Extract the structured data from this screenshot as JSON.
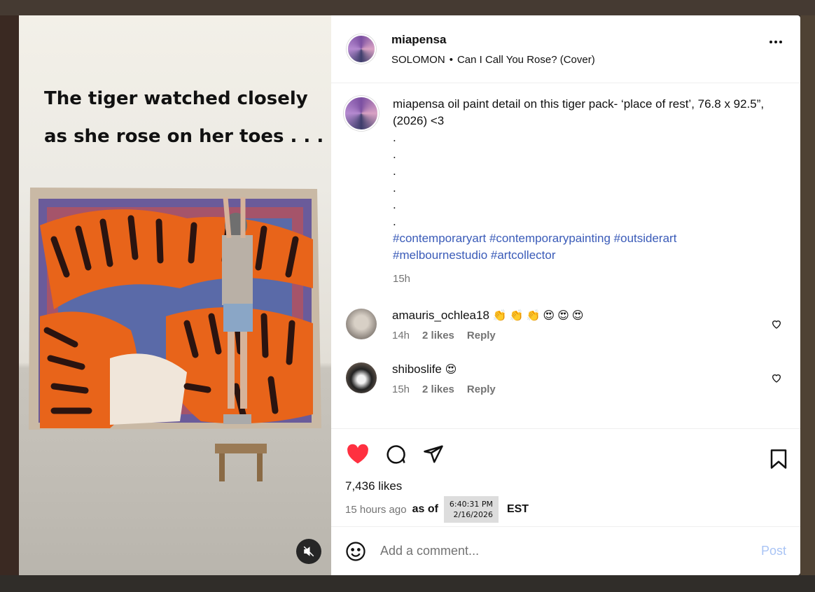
{
  "media": {
    "overlay_text_line1": "The tiger watched closely",
    "overlay_text_line2": "as she rose on her toes . . ."
  },
  "header": {
    "username": "miapensa",
    "audio_artist": "SOLOMON",
    "audio_separator": "•",
    "audio_title": "Can I Call You Rose? (Cover)"
  },
  "caption": {
    "username": "miapensa",
    "text": "oil paint detail on this tiger pack- ‘place of rest’, 76.8 x 92.5”, (2026) <3",
    "dots": [
      ".",
      ".",
      ".",
      ".",
      ".",
      "."
    ],
    "hashtags_line1": [
      "#contemporaryart",
      "#contemporarypainting",
      "#outsiderart"
    ],
    "hashtags_line2": [
      "#melbournestudio",
      "#artcollector"
    ],
    "time": "15h"
  },
  "comments": [
    {
      "username": "amauris_ochlea18",
      "emoji": "👏👏👏😍😍😍",
      "time": "14h",
      "likes": "2 likes",
      "reply": "Reply"
    },
    {
      "username": "shiboslife",
      "emoji": "😍",
      "time": "15h",
      "likes": "2 likes",
      "reply": "Reply"
    }
  ],
  "actions": {
    "likes_count": "7,436 likes",
    "time_ago": "15 hours ago",
    "as_of": "as of",
    "stamp_time": "6:40:31 PM",
    "stamp_date": "2/16/2026",
    "timezone": "EST"
  },
  "add_comment": {
    "placeholder": "Add a comment...",
    "post_label": "Post"
  },
  "colors": {
    "heart_liked": "#ff3040",
    "hashtag": "#3a5bb8",
    "post_button_disabled": "#a9c4f5"
  }
}
